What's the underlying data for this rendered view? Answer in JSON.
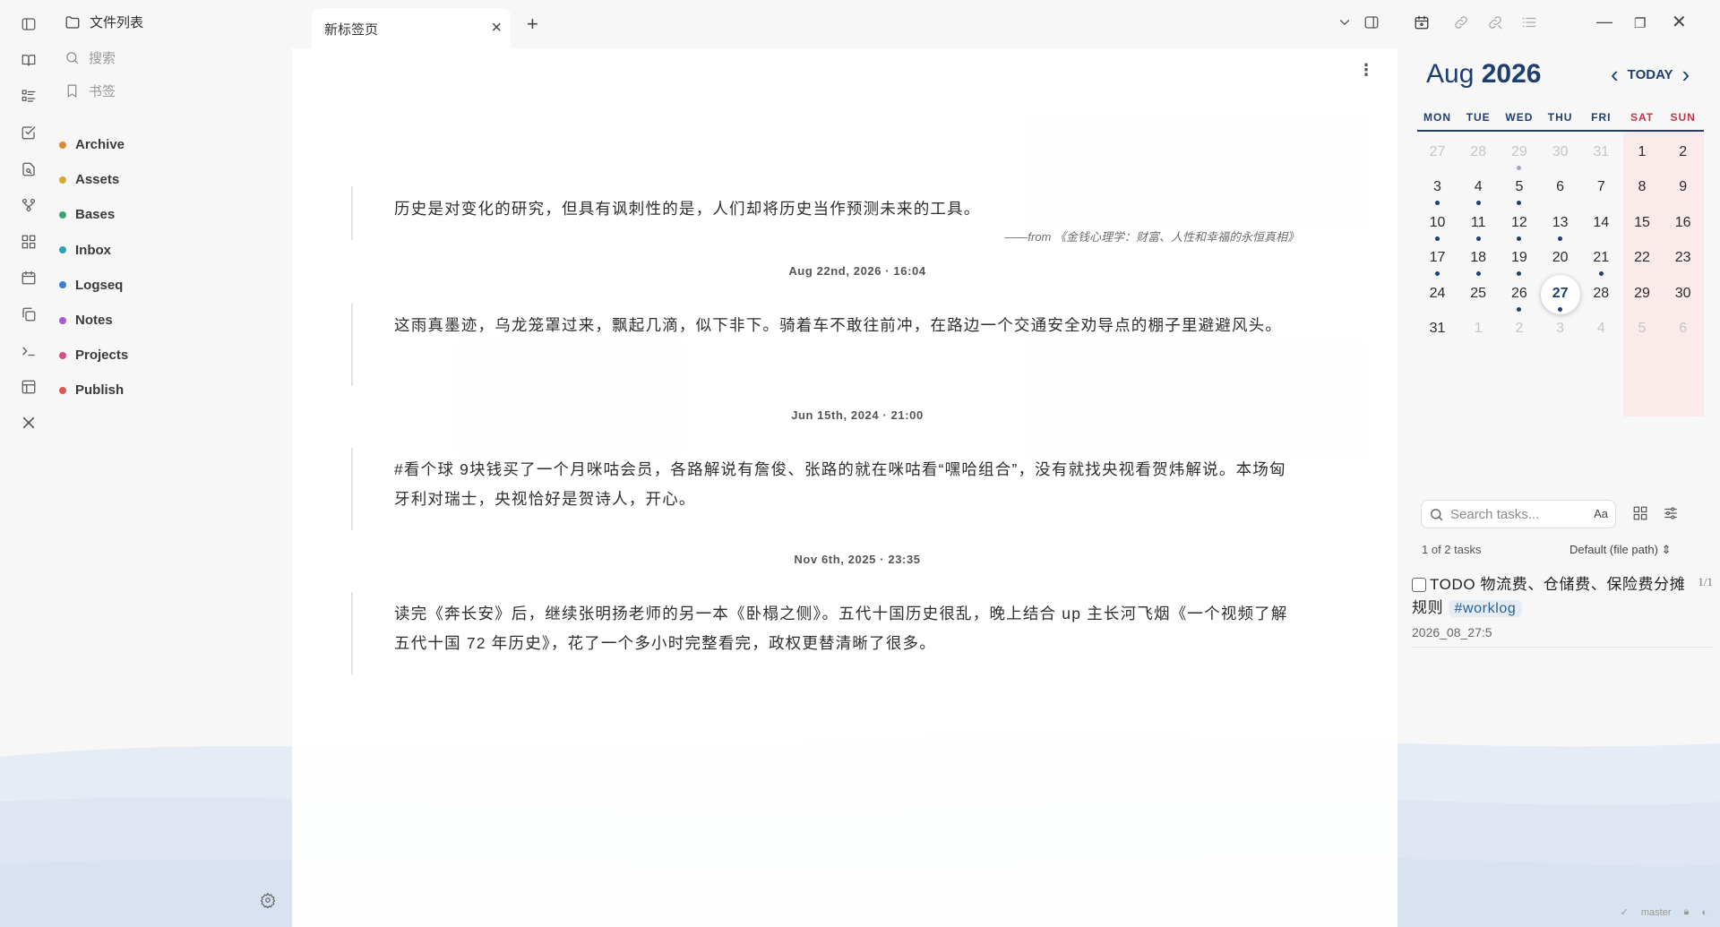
{
  "sidebar": {
    "header": "文件列表",
    "search": "搜索",
    "bookmarks": "书签",
    "folders": [
      {
        "name": "Archive",
        "color": "#d98b3a"
      },
      {
        "name": "Assets",
        "color": "#d6a83a"
      },
      {
        "name": "Bases",
        "color": "#3fa46a"
      },
      {
        "name": "Inbox",
        "color": "#2fa0b7"
      },
      {
        "name": "Logseq",
        "color": "#3f7fd0"
      },
      {
        "name": "Notes",
        "color": "#a55bd6"
      },
      {
        "name": "Projects",
        "color": "#d44f86"
      },
      {
        "name": "Publish",
        "color": "#dc5757"
      }
    ]
  },
  "tab": {
    "title": "新标签页",
    "close": "×",
    "add": "+"
  },
  "entries": [
    {
      "date": "",
      "text": "历史是对变化的研究，但具有讽刺性的是，人们却将历史当作预测未来的工具。",
      "source": "——from 《金钱心理学：财富、人性和幸福的永恒真相》"
    },
    {
      "date": "Aug 22nd, 2026 · 16:04",
      "text": "这雨真墨迹，乌龙笼罩过来，飘起几滴，似下非下。骑着车不敢往前冲，在路边一个交通安全劝导点的棚子里避避风头。",
      "source": ""
    },
    {
      "date": "Jun 15th, 2024 · 21:00",
      "text": "#看个球 9块钱买了一个月咪咕会员，各路解说有詹俊、张路的就在咪咕看“嘿哈组合”，没有就找央视看贺炜解说。本场匈牙利对瑞士，央视恰好是贺诗人，开心。",
      "source": ""
    },
    {
      "date": "Nov 6th, 2025 · 23:35",
      "text": "读完《奔长安》后，继续张明扬老师的另一本《卧榻之侧》。五代十国历史很乱，晚上结合 up 主长河飞烟《一个视频了解五代十国 72 年历史》，花了一个多小时完整看完，政权更替清晰了很多。",
      "source": ""
    }
  ],
  "calendar": {
    "month": "Aug",
    "year": "2026",
    "today_label": "TODAY",
    "weekdays": [
      "MON",
      "TUE",
      "WED",
      "THU",
      "FRI",
      "SAT",
      "SUN"
    ],
    "weeks": [
      [
        {
          "d": "27",
          "o": true
        },
        {
          "d": "28",
          "o": true
        },
        {
          "d": "29",
          "o": true,
          "dot": true
        },
        {
          "d": "30",
          "o": true
        },
        {
          "d": "31",
          "o": true
        },
        {
          "d": "1"
        },
        {
          "d": "2"
        }
      ],
      [
        {
          "d": "3",
          "dot": true
        },
        {
          "d": "4",
          "dot": true
        },
        {
          "d": "5",
          "dot": true
        },
        {
          "d": "6"
        },
        {
          "d": "7"
        },
        {
          "d": "8"
        },
        {
          "d": "9"
        }
      ],
      [
        {
          "d": "10",
          "dot": true
        },
        {
          "d": "11",
          "dot": true
        },
        {
          "d": "12",
          "dot": true
        },
        {
          "d": "13",
          "dot": true
        },
        {
          "d": "14"
        },
        {
          "d": "15"
        },
        {
          "d": "16"
        }
      ],
      [
        {
          "d": "17",
          "dot": true
        },
        {
          "d": "18",
          "dot": true
        },
        {
          "d": "19",
          "dot": true
        },
        {
          "d": "20"
        },
        {
          "d": "21",
          "dot": true
        },
        {
          "d": "22"
        },
        {
          "d": "23"
        }
      ],
      [
        {
          "d": "24"
        },
        {
          "d": "25"
        },
        {
          "d": "26",
          "dot": true
        },
        {
          "d": "27",
          "today": true,
          "dot": true
        },
        {
          "d": "28"
        },
        {
          "d": "29"
        },
        {
          "d": "30"
        }
      ],
      [
        {
          "d": "31"
        },
        {
          "d": "1",
          "o": true
        },
        {
          "d": "2",
          "o": true
        },
        {
          "d": "3",
          "o": true
        },
        {
          "d": "4",
          "o": true
        },
        {
          "d": "5",
          "o": true
        },
        {
          "d": "6",
          "o": true
        }
      ]
    ]
  },
  "tasks": {
    "search_placeholder": "Search tasks...",
    "case_toggle": "Aa",
    "count": "1 of 2 tasks",
    "sort": "Default (file path)",
    "items": [
      {
        "text_prefix": "TODO 物流费、仓储费、保险费分摊规则",
        "tag": "#worklog",
        "count": "1/1",
        "date": "2026_08_27:5"
      }
    ]
  },
  "status": {
    "branch": "master"
  }
}
